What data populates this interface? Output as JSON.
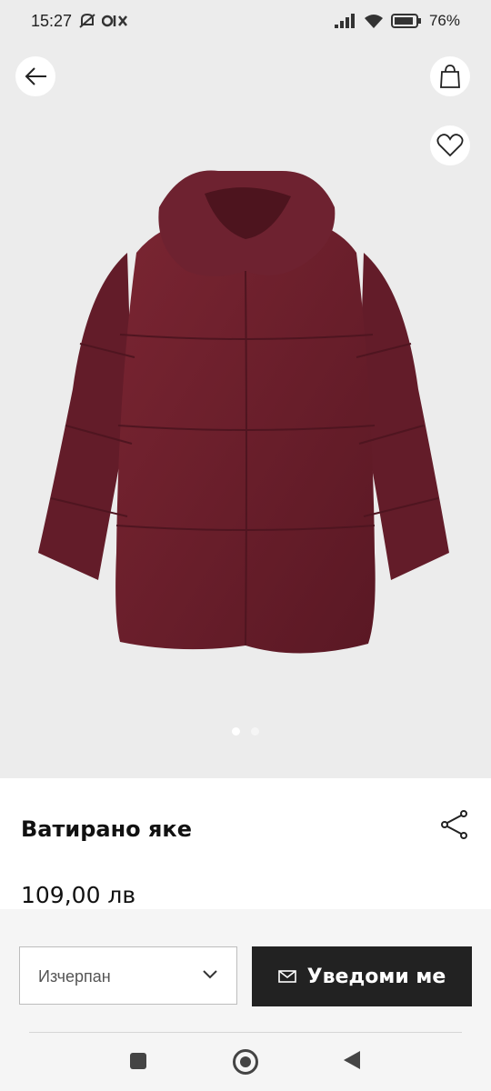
{
  "status": {
    "time": "15:27",
    "battery": "76"
  },
  "hero": {
    "image_icon": "puffer-jacket-image",
    "dots": 2,
    "active_dot": 0,
    "jacket_color": "#6b1f2b"
  },
  "product": {
    "title": "Ватирано яке",
    "price": "109,00 лв"
  },
  "actions": {
    "size_label": "Изчерпан",
    "notify_label": "Уведоми ме"
  },
  "colors": {
    "button_dark": "#222222",
    "hero_bg": "#ececec"
  }
}
